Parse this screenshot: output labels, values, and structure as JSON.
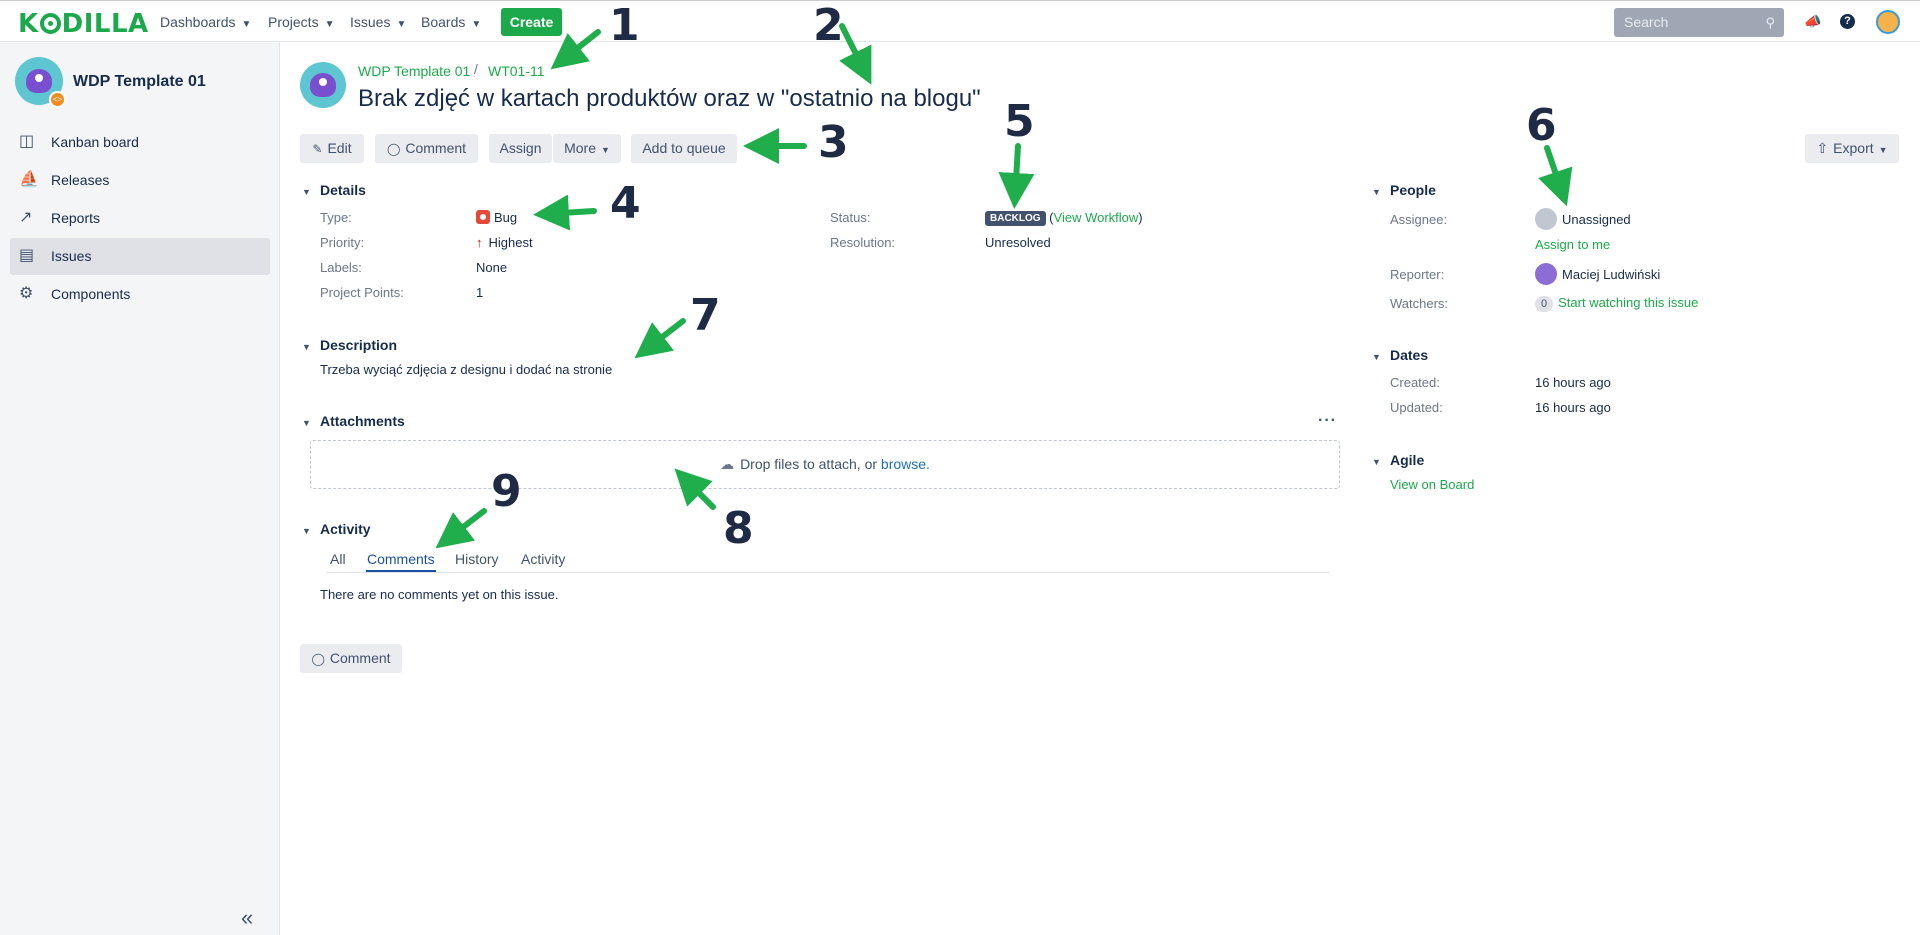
{
  "nav": {
    "items": [
      "Dashboards",
      "Projects",
      "Issues",
      "Boards"
    ],
    "create": "Create",
    "search_placeholder": "Search"
  },
  "sidebar": {
    "project_name": "WDP Template 01",
    "items": [
      {
        "label": "Kanban board",
        "icon": "board-icon"
      },
      {
        "label": "Releases",
        "icon": "ship-icon"
      },
      {
        "label": "Reports",
        "icon": "chart-icon"
      },
      {
        "label": "Issues",
        "icon": "issues-icon"
      },
      {
        "label": "Components",
        "icon": "puzzle-icon"
      }
    ]
  },
  "issue": {
    "breadcrumb_project": "WDP Template 01",
    "breadcrumb_key": "WT01-11",
    "title": "Brak zdjęć w kartach produktów oraz w \"ostatnio na blogu\""
  },
  "toolbar": {
    "edit": "Edit",
    "comment": "Comment",
    "assign": "Assign",
    "more": "More",
    "add_to_queue": "Add to queue",
    "export": "Export"
  },
  "details": {
    "heading": "Details",
    "type_label": "Type:",
    "type_value": "Bug",
    "priority_label": "Priority:",
    "priority_value": "Highest",
    "labels_label": "Labels:",
    "labels_value": "None",
    "points_label": "Project Points:",
    "points_value": "1",
    "status_label": "Status:",
    "status_value": "BACKLOG",
    "view_workflow": "View Workflow",
    "resolution_label": "Resolution:",
    "resolution_value": "Unresolved"
  },
  "description": {
    "heading": "Description",
    "text": "Trzeba wyciąć zdjęcia z designu i dodać na stronie"
  },
  "attachments": {
    "heading": "Attachments",
    "drop_text": "Drop files to attach, or",
    "browse": "browse."
  },
  "activity": {
    "heading": "Activity",
    "tabs": [
      "All",
      "Comments",
      "History",
      "Activity"
    ],
    "active_tab": "Comments",
    "empty_text": "There are no comments yet on this issue.",
    "comment_button": "Comment"
  },
  "people": {
    "heading": "People",
    "assignee_label": "Assignee:",
    "assignee_value": "Unassigned",
    "assign_to_me": "Assign to me",
    "reporter_label": "Reporter:",
    "reporter_value": "Maciej Ludwiński",
    "watchers_label": "Watchers:",
    "watchers_count": "0",
    "watch_link": "Start watching this issue"
  },
  "dates": {
    "heading": "Dates",
    "created_label": "Created:",
    "created_value": "16 hours ago",
    "updated_label": "Updated:",
    "updated_value": "16 hours ago"
  },
  "agile": {
    "heading": "Agile",
    "link": "View on Board"
  },
  "annotations": [
    "1",
    "2",
    "3",
    "4",
    "5",
    "6",
    "7",
    "8",
    "9"
  ],
  "colors": {
    "brand_green": "#1ca94b",
    "annotation_arrow": "#1fae4b",
    "annotation_number": "#1f2a44",
    "text_dark": "#172b4d",
    "link_blue": "#1c6fbf"
  }
}
